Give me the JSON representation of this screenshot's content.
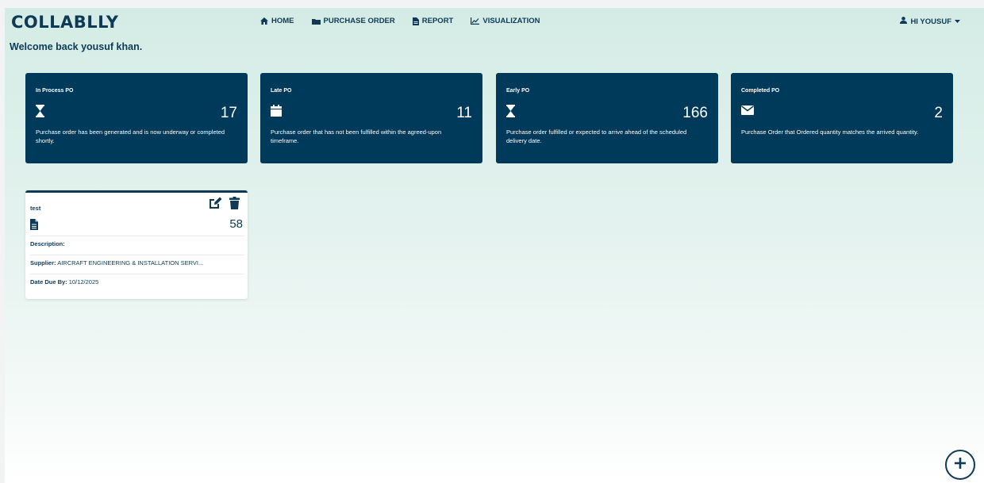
{
  "app": {
    "brand": "COLLABLLY"
  },
  "nav": {
    "items": [
      {
        "label": "HOME",
        "icon": "home-icon"
      },
      {
        "label": "PURCHASE ORDER",
        "icon": "folder-icon"
      },
      {
        "label": "REPORT",
        "icon": "document-icon"
      },
      {
        "label": "VISUALIZATION",
        "icon": "line-chart-icon"
      }
    ],
    "user": {
      "label": "HI YOUSUF",
      "icon": "user-icon"
    }
  },
  "welcome": "Welcome back yousuf khan.",
  "stats": [
    {
      "title": "In Process PO",
      "value": "17",
      "icon": "hourglass-icon",
      "description": "Purchase order has been generated and is now underway or completed shortly."
    },
    {
      "title": "Late PO",
      "value": "11",
      "icon": "calendar-icon",
      "description": "Purchase order that has not been fulfilled within the agreed-upon timeframe."
    },
    {
      "title": "Early PO",
      "value": "166",
      "icon": "hourglass-icon",
      "description": "Purchase order fulfilled or expected to arrive ahead of the scheduled delivery date."
    },
    {
      "title": "Completed PO",
      "value": "2",
      "icon": "envelope-icon",
      "description": "Purchase Order that Ordered quantity matches the arrived quantity."
    }
  ],
  "po_card": {
    "title": "test",
    "count": "58",
    "description_label": "Description:",
    "description_value": "",
    "supplier_label": "Supplier:",
    "supplier_value": "AIRCRAFT ENGINEERING & INSTALLATION SERVI...",
    "due_label": "Date Due By:",
    "due_value": "10/12/2025"
  },
  "colors": {
    "primary": "#003a5a",
    "text": "#0e3a56",
    "background_top": "#d4ece5"
  }
}
